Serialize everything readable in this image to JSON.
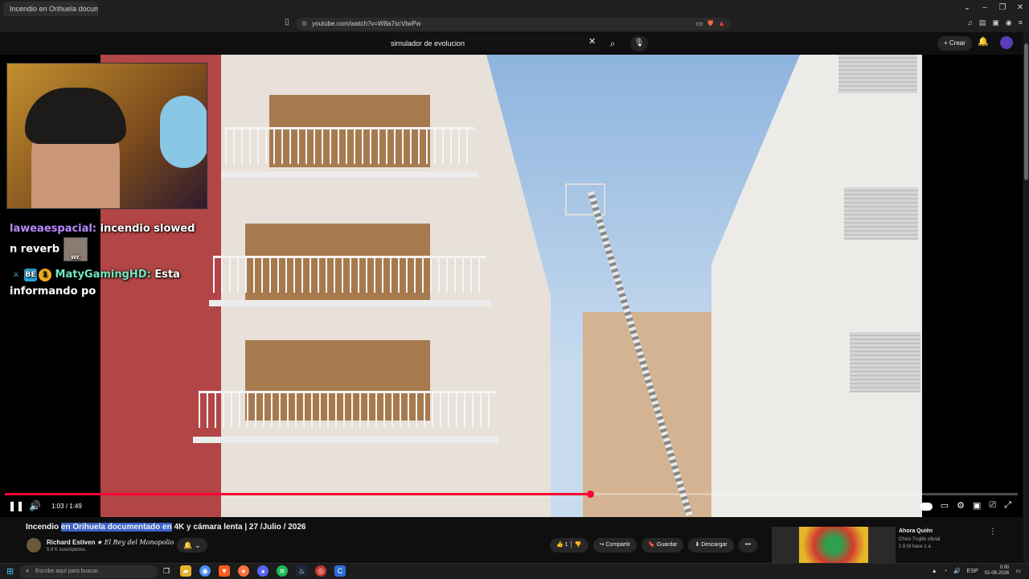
{
  "browser": {
    "tab_title": "Incendio en Orihuela docume...",
    "url": "youtube.com/watch?v=W8a7scVtwPw",
    "controls": [
      "⌄",
      "–",
      "❐",
      "✕"
    ]
  },
  "youtube": {
    "search_value": "simulador de evolucion",
    "create_label": "Crear"
  },
  "chat": [
    {
      "user": "laweaespacial",
      "message": "incendio slowed n reverb",
      "emote_label": "WE"
    },
    {
      "user": "MatyGamingHD",
      "message": "Esta informando po",
      "badges": [
        "⚔",
        "BE",
        "1"
      ]
    }
  ],
  "player": {
    "current_time": "1:03",
    "duration": "1:49",
    "time_display": "1:03 / 1:49",
    "progress_fraction": 0.578
  },
  "video": {
    "title_pre": "Incendio ",
    "title_hl1": "en ",
    "title_hl2": "Orihuela documentado en",
    "title_post": " 4K y cámara lenta | 27 /Julio / 2026",
    "channel_name": "Richard Estiven",
    "channel_tag": "★ El Rey del Monopolio",
    "subscribers": "5.9 K suscriptores",
    "likes": "1",
    "share_label": "Compartir",
    "save_label": "Guardar",
    "download_label": "Descargar"
  },
  "recommended": {
    "title": "Ahora Quién",
    "channel": "Chico Trujillo oficial",
    "meta": "1.6 M   hace 1 a"
  },
  "taskbar": {
    "search_placeholder": "Escribe aquí para buscar.",
    "language": "ESP",
    "time": "0:00",
    "date": "02-08-2026"
  },
  "colors": {
    "accent_red": "#ff0033",
    "highlight_blue": "#3d62c9",
    "chat_user1": "#b98aff",
    "chat_user2": "#74e6bf"
  }
}
